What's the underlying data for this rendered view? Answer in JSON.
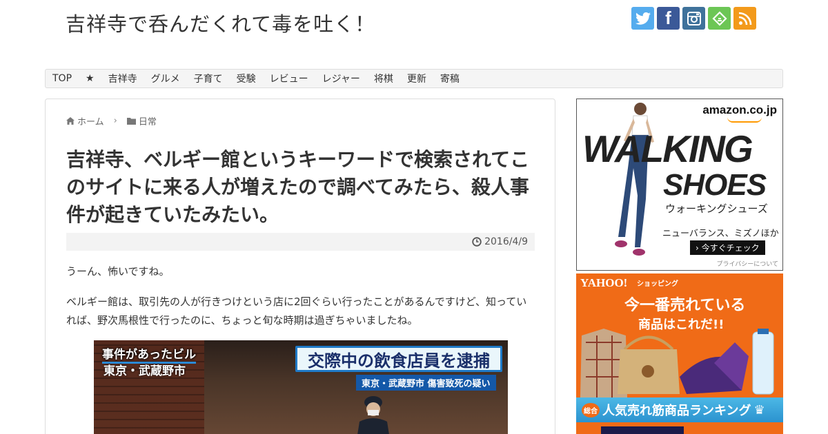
{
  "site": {
    "title": "吉祥寺で呑んだくれて毒を吐く！"
  },
  "social": [
    {
      "name": "twitter",
      "glyph": "t"
    },
    {
      "name": "facebook",
      "glyph": "f"
    },
    {
      "name": "instagram",
      "glyph": ""
    },
    {
      "name": "feedly",
      "glyph": ""
    },
    {
      "name": "rss",
      "glyph": ""
    }
  ],
  "nav": {
    "items": [
      "TOP",
      "★",
      "吉祥寺",
      "グルメ",
      "子育て",
      "受験",
      "レビュー",
      "レジャー",
      "将棋",
      "更新",
      "寄稿"
    ]
  },
  "breadcrumb": {
    "home": "ホーム",
    "category": "日常"
  },
  "post": {
    "title": "吉祥寺、ベルギー館というキーワードで検索されてこのサイトに来る人が増えたので調べてみたら、殺人事件が起きていたみたい。",
    "date": "2016/4/9",
    "para1": "うーん、怖いですね。",
    "para2": "ベルギー館は、取引先の人が行きつけという店に2回ぐらい行ったことがあるんですけど、知っていれば、野次馬根性で行ったのに、ちょっと旬な時期は過ぎちゃいましたね。"
  },
  "news_image": {
    "caption1": "事件があったビル",
    "caption2": "東京・武蔵野市",
    "headline": "交際中の飲食店員を逮捕",
    "subline": "東京・武蔵野市 傷害致死の疑い"
  },
  "ad_amazon": {
    "brand": "amazon.co.jp",
    "headline1": "WALKING",
    "headline2": "SHOES",
    "jp": "ウォーキングシューズ",
    "brands": "ニューバランス、ミズノほか",
    "cta": "› 今すぐチェック",
    "privacy": "プライバシーについて"
  },
  "ad_yahoo": {
    "logo": "YAHOO!",
    "shop": "ショッピング",
    "line1": "今一番売れている",
    "line2": "商品はこれだ!!",
    "badge": "総合",
    "rank": "人気売れ筋商品ランキング"
  },
  "colors": {
    "twitter": "#55acee",
    "facebook": "#3b5998",
    "instagram": "#3f729b",
    "feedly": "#6cc655",
    "rss": "#f39a1b",
    "yahoo_orange": "#f06b17"
  }
}
